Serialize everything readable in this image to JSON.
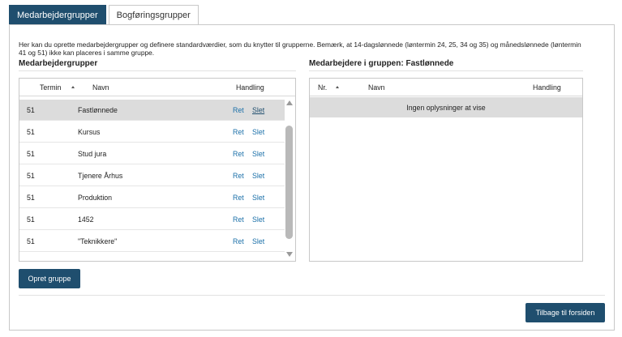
{
  "tabs": [
    {
      "label": "Medarbejdergrupper",
      "active": true
    },
    {
      "label": "Bogføringsgrupper",
      "active": false
    }
  ],
  "intro_text": "Her kan du oprette medarbejdergrupper og definere standardværdier, som du knytter til grupperne. Bemærk, at 14-dagslønnede (løntermin 24, 25, 34 og 35) og månedslønnede (løntermin 41 og 51) ikke kan placeres i samme gruppe.",
  "left_section": {
    "title": "Medarbejdergrupper",
    "columns": {
      "termin": "Termin",
      "navn": "Navn",
      "handling": "Handling"
    },
    "rows": [
      {
        "termin": "51",
        "navn": "Fastlønnede",
        "ret": "Ret",
        "slet": "Slet"
      },
      {
        "termin": "51",
        "navn": "Kursus",
        "ret": "Ret",
        "slet": "Slet"
      },
      {
        "termin": "51",
        "navn": "Stud jura",
        "ret": "Ret",
        "slet": "Slet"
      },
      {
        "termin": "51",
        "navn": "Tjenere Århus",
        "ret": "Ret",
        "slet": "Slet"
      },
      {
        "termin": "51",
        "navn": "Produktion",
        "ret": "Ret",
        "slet": "Slet"
      },
      {
        "termin": "51",
        "navn": "1452",
        "ret": "Ret",
        "slet": "Slet"
      },
      {
        "termin": "51",
        "navn": "\"Teknikkere\"",
        "ret": "Ret",
        "slet": "Slet"
      }
    ]
  },
  "right_section": {
    "title": "Medarbejdere i gruppen: Fastlønnede",
    "columns": {
      "nr": "Nr.",
      "navn": "Navn",
      "handling": "Handling"
    },
    "empty_message": "Ingen oplysninger at vise"
  },
  "buttons": {
    "create_group": "Opret gruppe",
    "back_home": "Tilbage til forsiden"
  },
  "colors": {
    "primary": "#1f4e6e",
    "link": "#1a6fa8",
    "selected_row": "#dcdcdc"
  }
}
